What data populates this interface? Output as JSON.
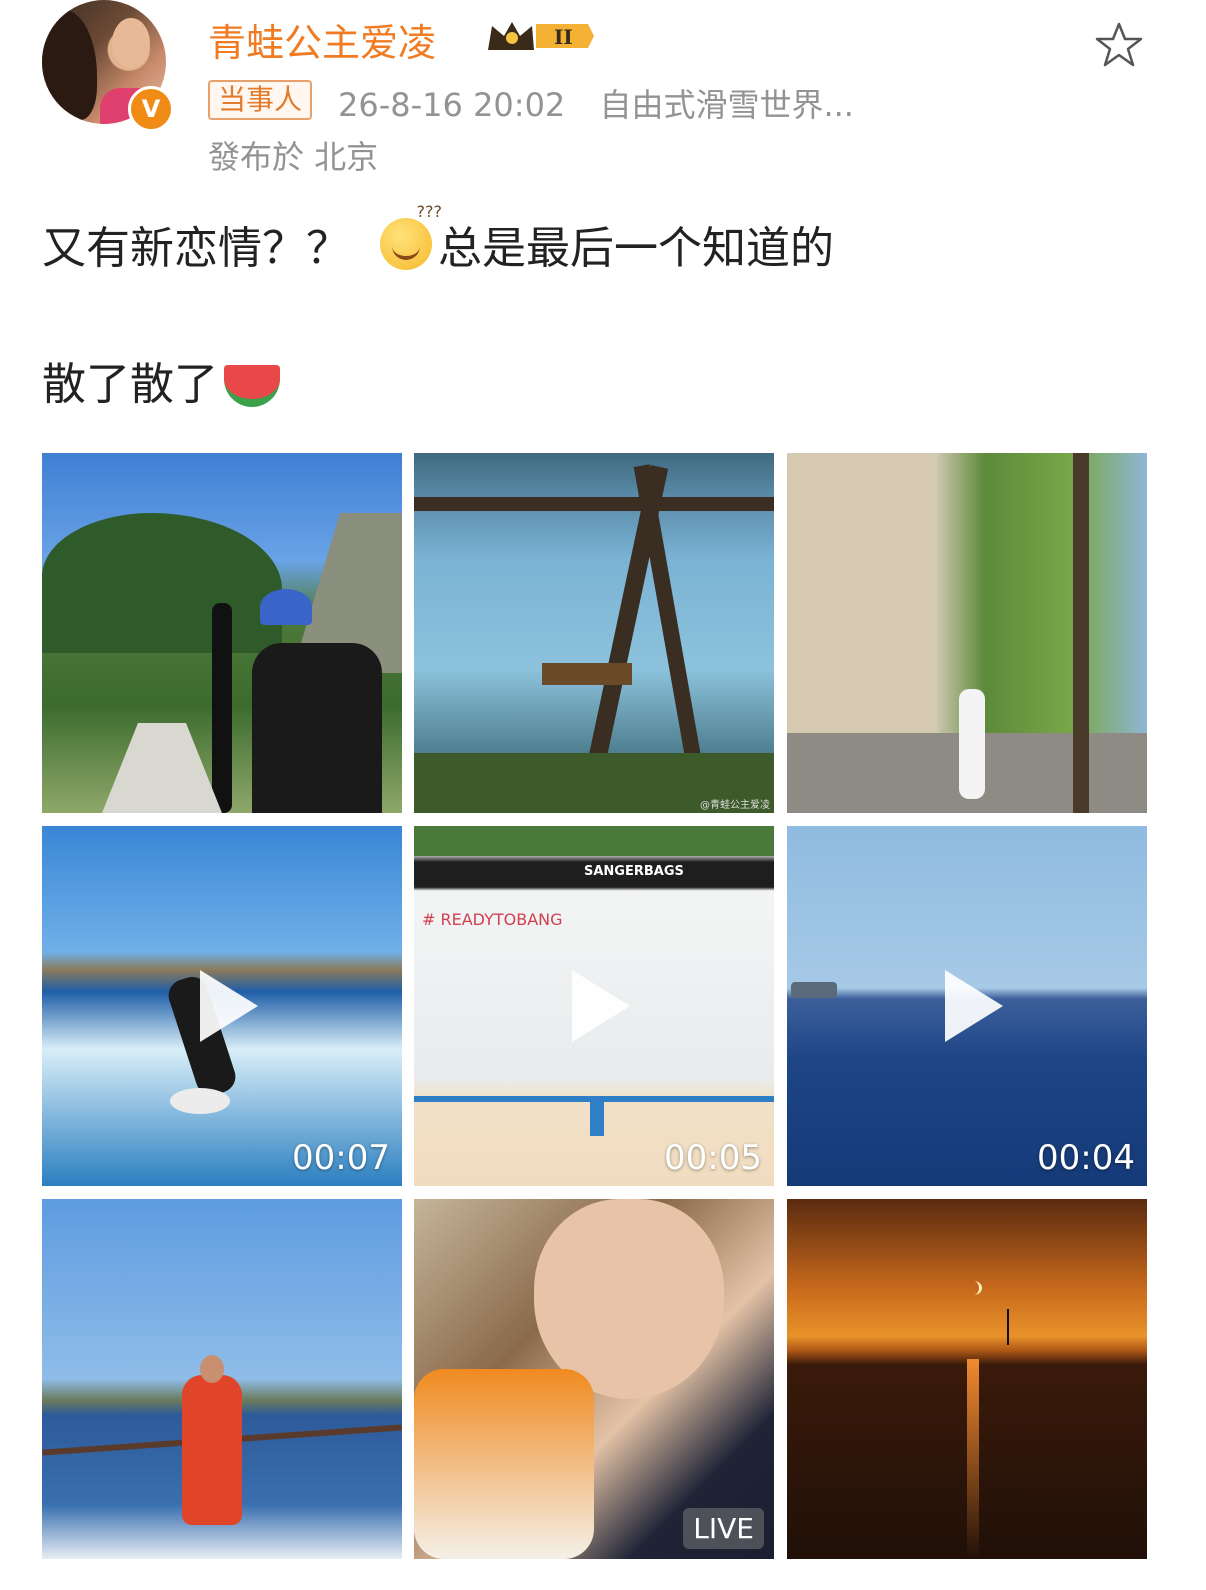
{
  "header": {
    "username": "青蛙公主爱凌",
    "badge_level": "II",
    "tag": "当事人",
    "datetime": "26-8-16 20:02",
    "source": "自由式滑雪世界...",
    "location": "發布於 北京",
    "verify_mark": "V"
  },
  "post": {
    "line1_before": "又有新恋情？？",
    "line1_after": "总是最后一个知道的",
    "line2": "散了散了"
  },
  "media": [
    {
      "kind": "image",
      "desc_icon": "photo-icon"
    },
    {
      "kind": "image",
      "watermark": "@青蛙公主爱凌"
    },
    {
      "kind": "image"
    },
    {
      "kind": "video",
      "duration": "00:07"
    },
    {
      "kind": "video",
      "duration": "00:05",
      "banner": "SANGERBAGS",
      "wall_text": "# READYTOBANG"
    },
    {
      "kind": "video",
      "duration": "00:04"
    },
    {
      "kind": "image"
    },
    {
      "kind": "live",
      "label": "LIVE"
    },
    {
      "kind": "image"
    }
  ],
  "colors": {
    "username": "#f07b22",
    "meta": "#939393",
    "text": "#222222",
    "tag_border": "#e8a06a"
  }
}
